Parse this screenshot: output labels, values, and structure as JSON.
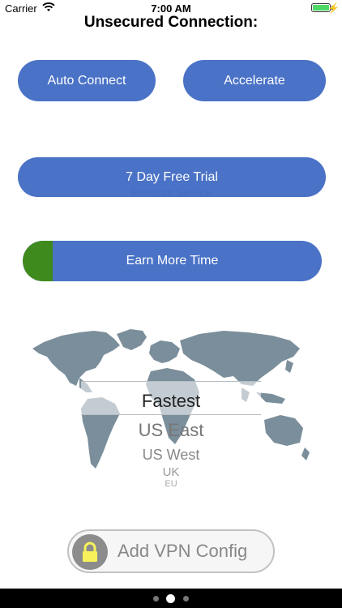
{
  "status": {
    "carrier": "Carrier",
    "time": "7:00 AM"
  },
  "title": "Unsecured Connection:",
  "buttons": {
    "auto_connect": "Auto Connect",
    "accelerate": "Accelerate",
    "trial": "7 Day Free Trial",
    "trial_sub": "Premium Service",
    "earn": "Earn More Time",
    "earn_progress": 0.1
  },
  "picker": {
    "options": [
      "Fastest",
      "US East",
      "US West",
      "UK",
      "EU"
    ],
    "selected": "Fastest"
  },
  "vpn": {
    "label": "Add VPN Config"
  },
  "pager": {
    "count": 3,
    "active": 1
  },
  "colors": {
    "accent": "#4a72c6",
    "progress": "#3f8a1c",
    "lock": "#f7f25a"
  }
}
